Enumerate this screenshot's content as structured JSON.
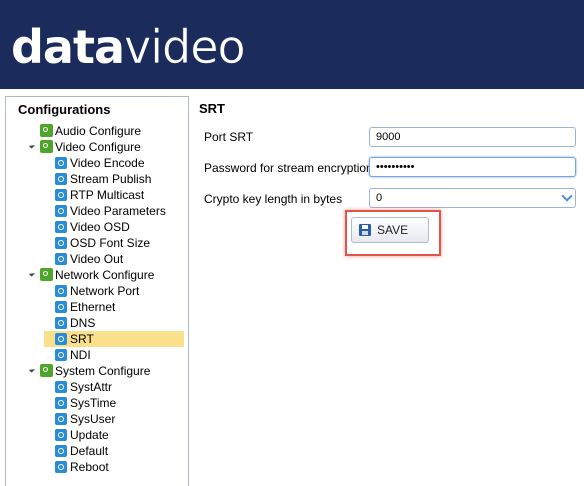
{
  "header": {
    "logo_bold": "data",
    "logo_thin": "video"
  },
  "sidebar": {
    "title": "Configurations",
    "groups": [
      {
        "label": "Audio Configure",
        "expanded": false,
        "items": []
      },
      {
        "label": "Video Configure",
        "expanded": true,
        "items": [
          "Video Encode",
          "Stream Publish",
          "RTP Multicast",
          "Video Parameters",
          "Video OSD",
          "OSD Font Size",
          "Video Out"
        ]
      },
      {
        "label": "Network Configure",
        "expanded": true,
        "items": [
          "Network Port",
          "Ethernet",
          "DNS",
          "SRT",
          "NDI"
        ]
      },
      {
        "label": "System Configure",
        "expanded": true,
        "items": [
          "SystAttr",
          "SysTime",
          "SysUser",
          "Update",
          "Default",
          "Reboot"
        ]
      }
    ],
    "selected": "SRT"
  },
  "main": {
    "title": "SRT",
    "port_label": "Port SRT",
    "port_value": "9000",
    "password_label": "Password for stream encryption",
    "password_value": "••••••••••",
    "crypto_label": "Crypto key length in bytes",
    "crypto_value": "0",
    "save_label": "SAVE"
  },
  "colors": {
    "header_bg": "#1b2b5c",
    "selected_bg": "#fbe08b",
    "group_icon": "#4ea52a",
    "item_icon": "#2a8bd6",
    "highlight": "#e0554a"
  }
}
